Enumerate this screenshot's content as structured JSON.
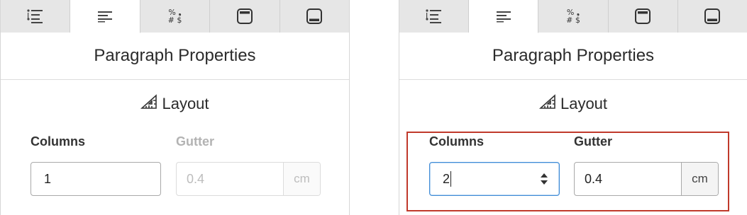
{
  "tabs": [
    {
      "name": "list-outline",
      "icon": "list-outline-icon"
    },
    {
      "name": "paragraph",
      "icon": "paragraph-align-icon"
    },
    {
      "name": "special-chars",
      "icon": "special-characters-icon",
      "glyph_top": "% ❟",
      "glyph_bottom": "# $"
    },
    {
      "name": "header",
      "icon": "header-layout-icon"
    },
    {
      "name": "footer",
      "icon": "footer-layout-icon"
    }
  ],
  "before": {
    "title": "Paragraph Properties",
    "section": "Layout",
    "columns_label": "Columns",
    "columns_value": "1",
    "gutter_label": "Gutter",
    "gutter_value": "0.4",
    "gutter_unit": "cm"
  },
  "after": {
    "title": "Paragraph Properties",
    "section": "Layout",
    "columns_label": "Columns",
    "columns_value": "2",
    "gutter_label": "Gutter",
    "gutter_value": "0.4",
    "gutter_unit": "cm"
  },
  "colors": {
    "highlight": "#c0392b",
    "focus": "#3f8bd6"
  }
}
